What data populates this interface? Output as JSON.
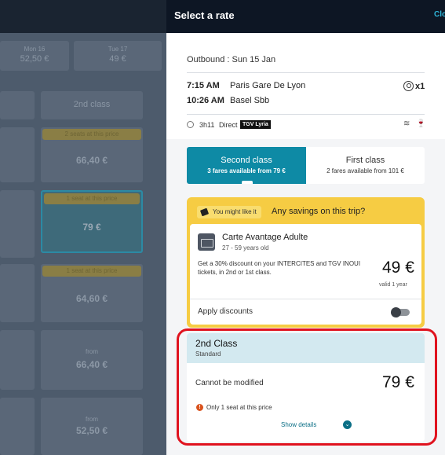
{
  "background": {
    "dates": [
      {
        "day": "Mon 16",
        "price": "52,50 €"
      },
      {
        "day": "Tue 17",
        "price": "49 €"
      }
    ],
    "column_header": "2nd class",
    "rows": [
      {
        "badge": "2 seats at this price",
        "price": "66,40 €"
      },
      {
        "badge": "1 seat at this price",
        "price": "79 €"
      },
      {
        "badge": "1 seat at this price",
        "price": "64,60 €"
      },
      {
        "label": "from",
        "price": "66,40 €"
      },
      {
        "label": "from",
        "price": "52,50 €"
      }
    ]
  },
  "panel": {
    "title": "Select a rate",
    "close_label": "Clo"
  },
  "journey": {
    "outbound": "Outbound : Sun 15 Jan",
    "departure_time": "7:15 AM",
    "departure_station": "Paris Gare De Lyon",
    "arrival_time": "10:26 AM",
    "arrival_station": "Basel Sbb",
    "passengers": "x1",
    "duration": "3h11",
    "type": "Direct",
    "operator": "TGV Lyria"
  },
  "class_tabs": {
    "second": {
      "label": "Second class",
      "sub": "3 fares available from 79 €"
    },
    "first": {
      "label": "First class",
      "sub": "2 fares available from 101 €"
    }
  },
  "promo": {
    "tag": "You might like it",
    "question": "Any savings on this trip?",
    "card_title": "Carte Avantage Adulte",
    "card_age": "27 - 59 years old",
    "card_desc": "Get a 30% discount on your INTERCITES and TGV INOUI tickets, in 2nd or 1st class.",
    "card_price": "49 €",
    "card_valid": "valid 1 year",
    "apply_label": "Apply discounts"
  },
  "fare": {
    "class": "2nd Class",
    "type": "Standard",
    "condition": "Cannot be modified",
    "price": "79 €",
    "seat_message": "Only 1 seat at this price",
    "show_details": "Show details"
  },
  "colors": {
    "accent": "#0e8aa5",
    "promo": "#f6cc43",
    "highlight": "#e0131f"
  }
}
